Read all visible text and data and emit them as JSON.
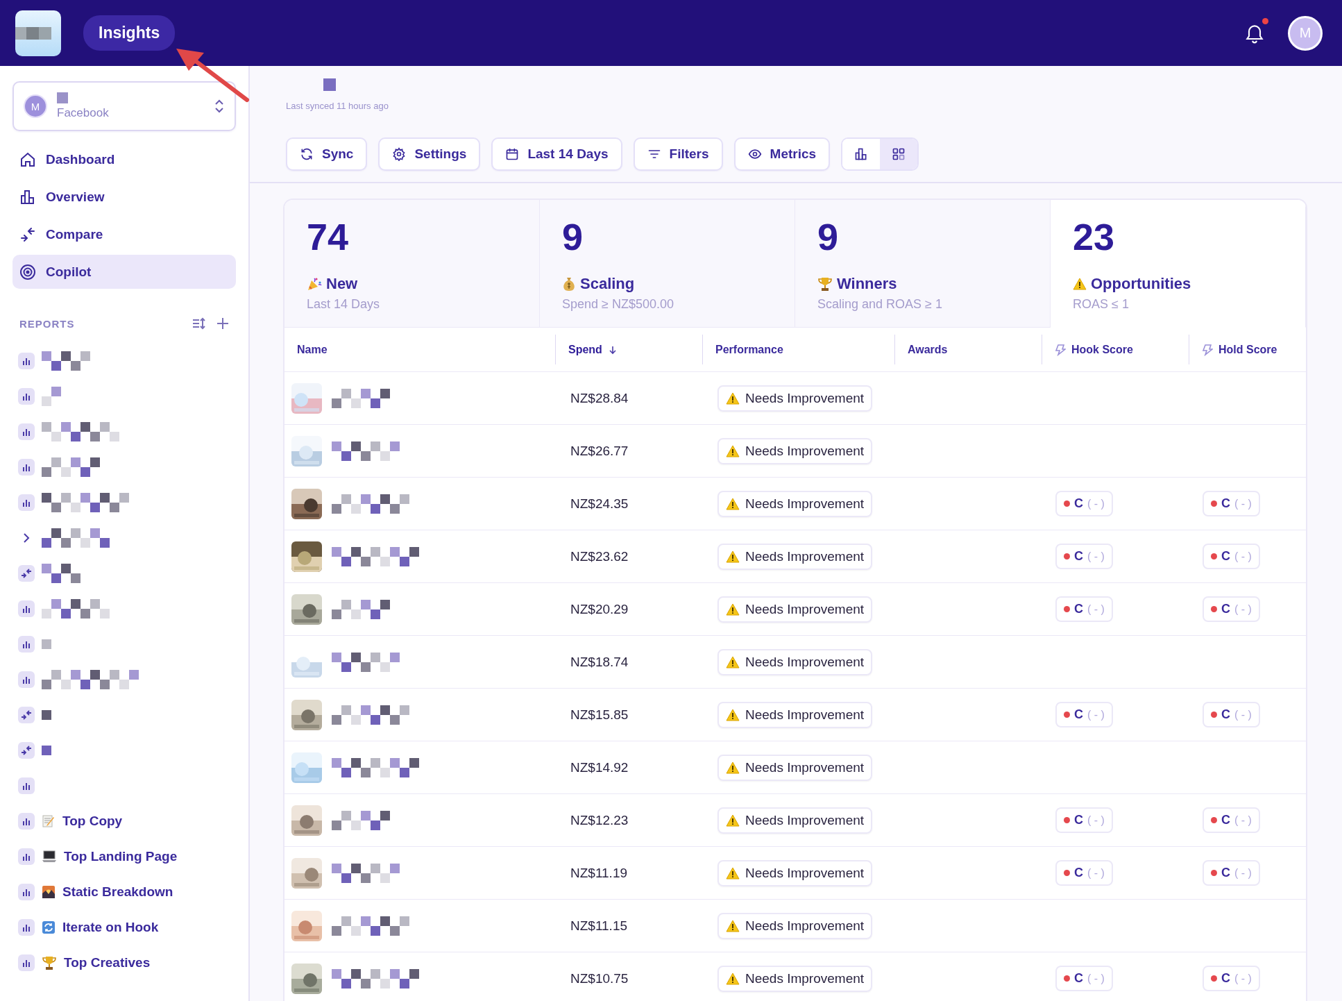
{
  "topbar": {
    "app_tab": "Insights",
    "notifications": true,
    "avatar": "M"
  },
  "account": {
    "avatar": "M",
    "platform": "Facebook"
  },
  "nav": [
    {
      "label": "Dashboard",
      "selected": false
    },
    {
      "label": "Overview",
      "selected": false
    },
    {
      "label": "Compare",
      "selected": false
    },
    {
      "label": "Copilot",
      "selected": true
    }
  ],
  "reports": {
    "title": "REPORTS",
    "items": [
      {
        "kind": "chart"
      },
      {
        "kind": "chart"
      },
      {
        "kind": "chart"
      },
      {
        "kind": "chart"
      },
      {
        "kind": "chart"
      },
      {
        "kind": "folder"
      },
      {
        "kind": "comparison"
      },
      {
        "kind": "chart"
      },
      {
        "kind": "chart"
      },
      {
        "kind": "chart"
      },
      {
        "kind": "comparison"
      },
      {
        "kind": "comparison"
      },
      {
        "kind": "chart"
      },
      {
        "kind": "chart",
        "label": "Top Copy"
      },
      {
        "kind": "chart",
        "label": "Top Landing Page"
      },
      {
        "kind": "chart",
        "label": "Static Breakdown"
      },
      {
        "kind": "chart",
        "label": "Iterate on Hook"
      },
      {
        "kind": "chart",
        "label": "Top Creatives"
      }
    ]
  },
  "header": {
    "synced": "Last synced 11 hours ago"
  },
  "toolbar": [
    "Sync",
    "Settings",
    "Last 14 Days",
    "Filters",
    "Metrics"
  ],
  "view_toggle": [
    {
      "selected": false
    },
    {
      "selected": true
    }
  ],
  "stats": [
    {
      "value": "74",
      "title": "New",
      "subtitle": "Last 14 Days",
      "selected": false
    },
    {
      "value": "9",
      "title": "Scaling",
      "subtitle": "Spend ≥ NZ$500.00",
      "selected": false
    },
    {
      "value": "9",
      "title": "Winners",
      "subtitle": "Scaling and ROAS ≥ 1",
      "selected": false
    },
    {
      "value": "23",
      "title": "Opportunities",
      "subtitle": "ROAS ≤ 1",
      "selected": true
    }
  ],
  "table": {
    "columns": [
      {
        "label": "Name",
        "sorted": false
      },
      {
        "label": "Spend",
        "sorted": true
      },
      {
        "label": "Performance",
        "sorted": false
      },
      {
        "label": "Awards",
        "sorted": false
      },
      {
        "label": "Hook Score",
        "sorted": false
      },
      {
        "label": "Hold Score",
        "sorted": false
      }
    ],
    "rows": [
      {
        "spend": "NZ$28.84",
        "performance": "Needs Improvement"
      },
      {
        "spend": "NZ$26.77",
        "performance": "Needs Improvement"
      },
      {
        "spend": "NZ$24.35",
        "performance": "Needs Improvement",
        "hook": {
          "grade": "C",
          "change": "( - )"
        },
        "hold": {
          "grade": "C",
          "change": "( - )"
        }
      },
      {
        "spend": "NZ$23.62",
        "performance": "Needs Improvement",
        "hook": {
          "grade": "C",
          "change": "( - )"
        },
        "hold": {
          "grade": "C",
          "change": "( - )"
        }
      },
      {
        "spend": "NZ$20.29",
        "performance": "Needs Improvement",
        "hook": {
          "grade": "C",
          "change": "( - )"
        },
        "hold": {
          "grade": "C",
          "change": "( - )"
        }
      },
      {
        "spend": "NZ$18.74",
        "performance": "Needs Improvement"
      },
      {
        "spend": "NZ$15.85",
        "performance": "Needs Improvement",
        "hook": {
          "grade": "C",
          "change": "( - )"
        },
        "hold": {
          "grade": "C",
          "change": "( - )"
        }
      },
      {
        "spend": "NZ$14.92",
        "performance": "Needs Improvement"
      },
      {
        "spend": "NZ$12.23",
        "performance": "Needs Improvement",
        "hook": {
          "grade": "C",
          "change": "( - )"
        },
        "hold": {
          "grade": "C",
          "change": "( - )"
        }
      },
      {
        "spend": "NZ$11.19",
        "performance": "Needs Improvement",
        "hook": {
          "grade": "C",
          "change": "( - )"
        },
        "hold": {
          "grade": "C",
          "change": "( - )"
        }
      },
      {
        "spend": "NZ$11.15",
        "performance": "Needs Improvement"
      },
      {
        "spend": "NZ$10.75",
        "performance": "Needs Improvement",
        "hook": {
          "grade": "C",
          "change": "( - )"
        },
        "hold": {
          "grade": "C",
          "change": "( - )"
        }
      }
    ]
  }
}
